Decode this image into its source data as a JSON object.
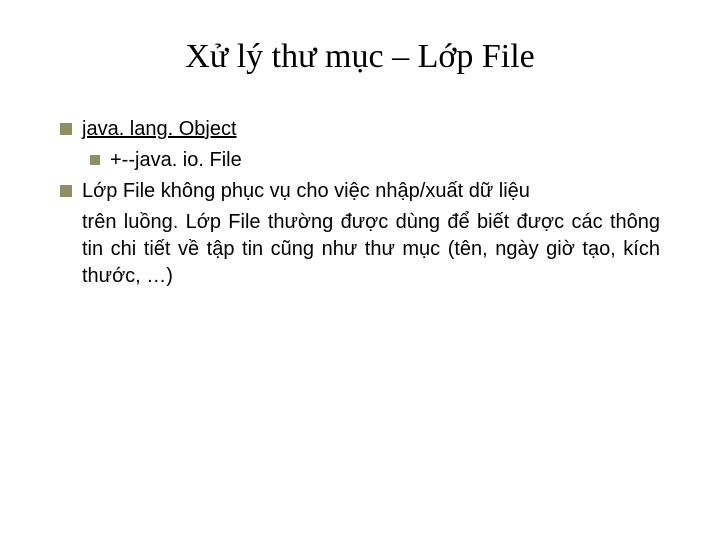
{
  "title": "Xử lý thư mục – Lớp File",
  "items": {
    "link": "java. lang. Object",
    "sub": "+--java. io. File",
    "body_lead": "Lớp File không phục vụ cho việc nhập/xuất dữ liệu",
    "body_rest": "trên luồng. Lớp File  thường được dùng để biết được các thông tin chi tiết về tập tin cũng như thư mục (tên, ngày giờ tạo, kích thước, …)"
  }
}
